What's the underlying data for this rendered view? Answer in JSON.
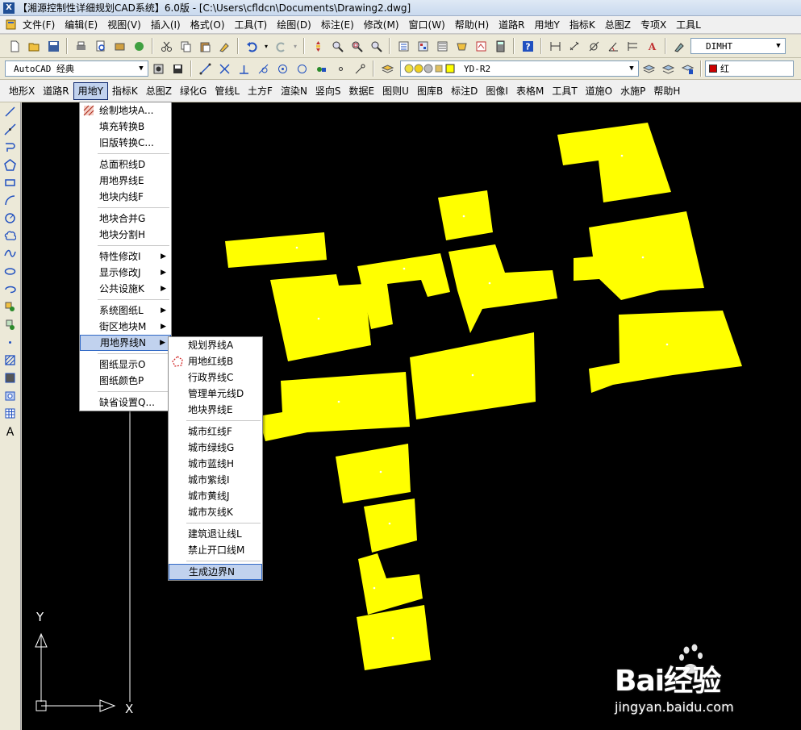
{
  "title": "【湘源控制性详细规划CAD系统】6.0版 - [C:\\Users\\cfldcn\\Documents\\Drawing2.dwg]",
  "menubar": [
    "文件(F)",
    "编辑(E)",
    "视图(V)",
    "插入(I)",
    "格式(O)",
    "工具(T)",
    "绘图(D)",
    "标注(E)",
    "修改(M)",
    "窗口(W)",
    "帮助(H)",
    "道路R",
    "用地Y",
    "指标K",
    "总图Z",
    "专项X",
    "工具L"
  ],
  "toolbar2": {
    "workspace": "AutoCAD 经典",
    "layer": "YD-R2",
    "dimstyle": "DIMHT",
    "color_label": "红",
    "color": "#cc0000"
  },
  "menubar2": {
    "items": [
      "地形X",
      "道路R",
      "用地Y",
      "指标K",
      "总图Z",
      "绿化G",
      "管线L",
      "土方F",
      "渲染N",
      "竖向S",
      "数据E",
      "图则U",
      "图库B",
      "标注D",
      "图像I",
      "表格M",
      "工具T",
      "道施O",
      "水施P",
      "帮助H"
    ],
    "active_index": 2
  },
  "yongdi_menu": {
    "groups": [
      [
        "绘制地块A...",
        "填充转换B",
        "旧版转换C..."
      ],
      [
        "总面积线D",
        "用地界线E",
        "地块内线F"
      ],
      [
        "地块合并G",
        "地块分割H"
      ],
      [
        "特性修改I",
        "显示修改J",
        "公共设施K"
      ],
      [
        "系统图纸L",
        "街区地块M",
        "用地界线N"
      ],
      [
        "图纸显示O",
        "图纸颜色P"
      ],
      [
        "缺省设置Q..."
      ]
    ],
    "submenu_flags": [
      "特性修改I",
      "显示修改J",
      "公共设施K",
      "系统图纸L",
      "街区地块M",
      "用地界线N"
    ],
    "highlighted": "用地界线N"
  },
  "jiexian_submenu": {
    "groups": [
      [
        "规划界线A",
        "用地红线B",
        "行政界线C",
        "管理单元线D",
        "地块界线E"
      ],
      [
        "城市红线F",
        "城市绿线G",
        "城市蓝线H",
        "城市紫线I",
        "城市黄线J",
        "城市灰线K"
      ],
      [
        "建筑退让线L",
        "禁止开口线M"
      ],
      [
        "生成边界N"
      ]
    ],
    "highlighted": "生成边界N"
  },
  "ucs": {
    "y_label": "Y",
    "x_label": "X"
  },
  "watermark": {
    "logo": "Bai经验",
    "url": "jingyan.baidu.com"
  },
  "parcel_color": "#ffff00"
}
